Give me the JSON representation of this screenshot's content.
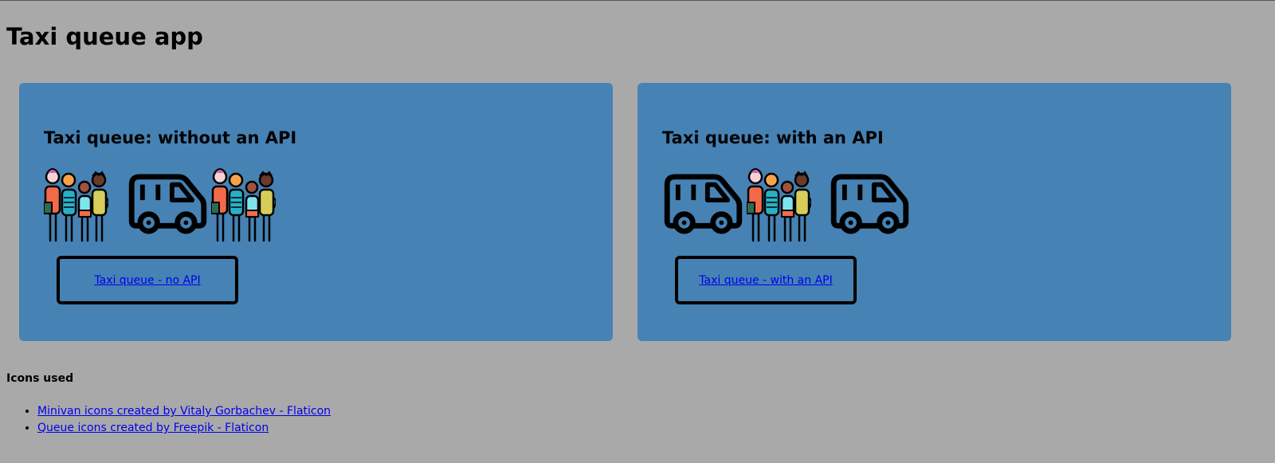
{
  "page": {
    "title": "Taxi queue app"
  },
  "cards": [
    {
      "title": "Taxi queue: without an API",
      "link_label": "Taxi queue - no API",
      "illustration": [
        "queue-icon",
        "minivan-icon",
        "queue-icon"
      ]
    },
    {
      "title": "Taxi queue: with an API",
      "link_label": "Taxi queue - with an API",
      "illustration": [
        "minivan-icon",
        "queue-icon",
        "minivan-icon"
      ]
    }
  ],
  "credits": {
    "heading": "Icons used",
    "links": [
      "Minivan icons created by Vitaly Gorbachev - Flaticon",
      "Queue icons created by Freepik - Flaticon"
    ]
  },
  "colors": {
    "background": "#a9a9a9",
    "card": "#4682b4",
    "link": "#0000ee"
  }
}
